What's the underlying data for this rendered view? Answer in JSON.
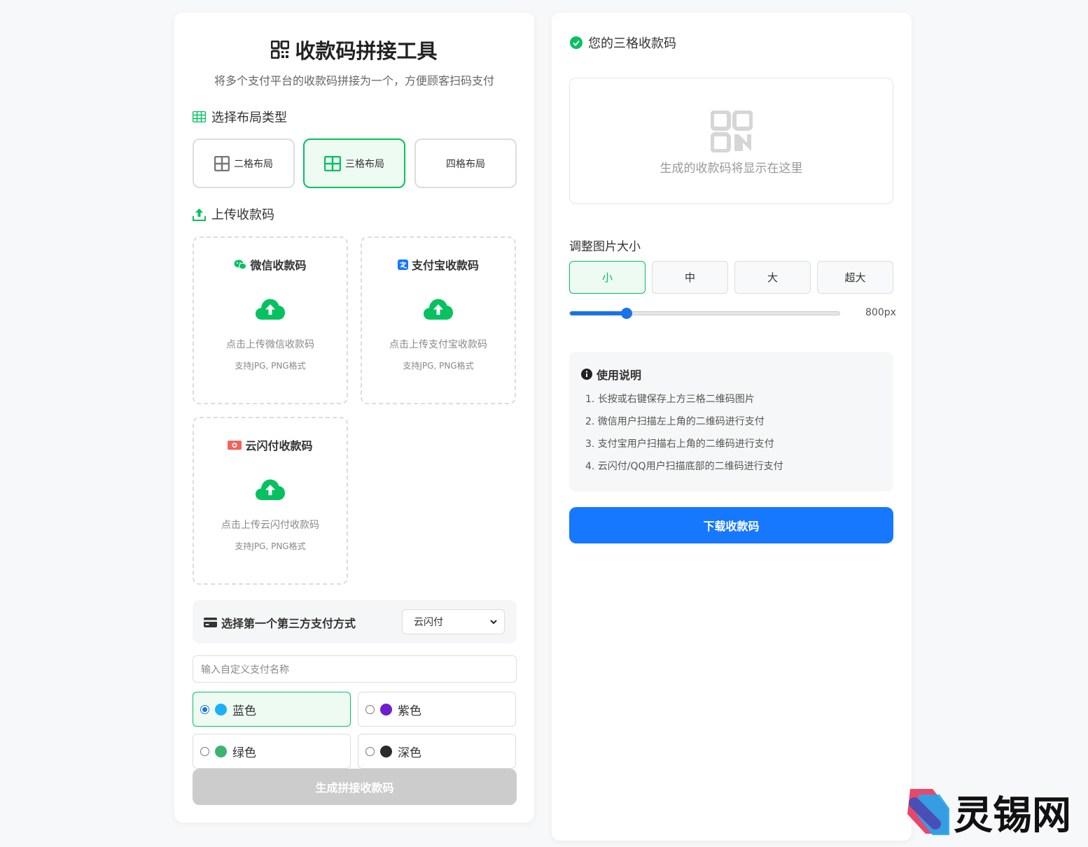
{
  "header": {
    "title": "收款码拼接工具",
    "subtitle": "将多个支付平台的收款码拼接为一个，方便顾客扫码支付"
  },
  "layout_section": {
    "title": "选择布局类型",
    "options": [
      {
        "label": "二格布局",
        "active": false
      },
      {
        "label": "三格布局",
        "active": true
      },
      {
        "label": "四格布局",
        "active": false
      }
    ]
  },
  "upload_section": {
    "title": "上传收款码",
    "boxes": [
      {
        "title": "微信收款码",
        "hint": "点击上传微信收款码",
        "format": "支持JPG, PNG格式"
      },
      {
        "title": "支付宝收款码",
        "hint": "点击上传支付宝收款码",
        "format": "支持JPG, PNG格式"
      },
      {
        "title": "云闪付收款码",
        "hint": "点击上传云闪付收款码",
        "format": "支持JPG, PNG格式"
      }
    ]
  },
  "third_party": {
    "label": "选择第一个第三方支付方式",
    "selected": "云闪付"
  },
  "custom_name": {
    "placeholder": "输入自定义支付名称"
  },
  "colors": [
    {
      "label": "蓝色",
      "hex": "#1cb0f6",
      "checked": true
    },
    {
      "label": "紫色",
      "hex": "#6f1ecf",
      "checked": false
    },
    {
      "label": "绿色",
      "hex": "#3cb371",
      "checked": false
    },
    {
      "label": "深色",
      "hex": "#2b2b2b",
      "checked": false
    }
  ],
  "generate_button": "生成拼接收款码",
  "result": {
    "title": "您的三格收款码",
    "placeholder": "生成的收款码将显示在这里"
  },
  "size": {
    "title": "调整图片大小",
    "options": [
      {
        "label": "小",
        "active": true
      },
      {
        "label": "中",
        "active": false
      },
      {
        "label": "大",
        "active": false
      },
      {
        "label": "超大",
        "active": false
      }
    ],
    "slider_fraction": 0.21,
    "value_label": "800px"
  },
  "instructions": {
    "title": "使用说明",
    "items": [
      "1. 长按或右键保存上方三格二维码图片",
      "2. 微信用户扫描左上角的二维码进行支付",
      "3. 支付宝用户扫描右上角的二维码进行支付",
      "4. 云闪付/QQ用户扫描底部的二维码进行支付"
    ]
  },
  "download_button": "下载收款码",
  "watermark": "灵锡网",
  "theme": {
    "accent_green": "#07c160",
    "accent_blue": "#1677ff"
  }
}
